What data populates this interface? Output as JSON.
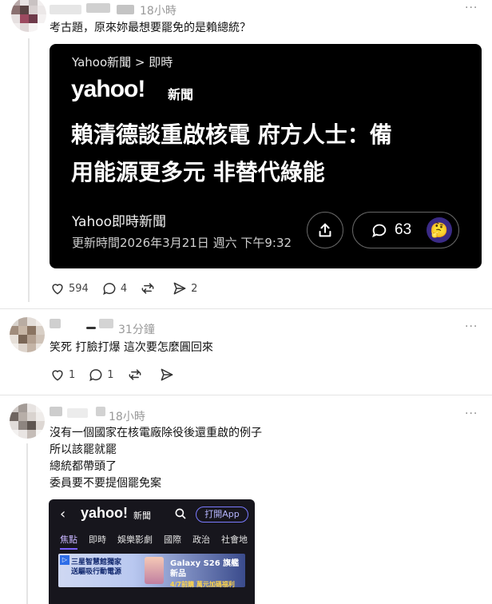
{
  "post1": {
    "time": "18小時",
    "text": "考古題，原來妳最想要罷免的是賴總統？",
    "more": "···",
    "card": {
      "crumb": "Yahoo新聞 > 即時",
      "logo": "yahoo!",
      "logo_sub": "新聞",
      "headline_line1": "賴清德談重啟核電 府方人士：備",
      "headline_line2": "用能源更多元 非替代綠能",
      "source": "Yahoo即時新聞",
      "updated": "更新時間2026年3月21日 週六 下午9:32",
      "comment_count": "63"
    },
    "likes": "594",
    "comments": "4",
    "shares": "2"
  },
  "post2": {
    "time": "31分鐘",
    "text": "笑死 打臉打爆 這次要怎麼圓回來",
    "more": "···",
    "likes": "1",
    "comments": "1"
  },
  "post3": {
    "time": "18小時",
    "more": "···",
    "lines": [
      "沒有一個國家在核電廠除役後還重啟的例子",
      "所以該罷就罷",
      "總統都帶頭了",
      "委員要不要提個罷免案"
    ],
    "phone": {
      "back": "‹",
      "logo": "yahoo!",
      "logo_sub": "新聞",
      "app_button": "打開App",
      "tabs": [
        "焦點",
        "即時",
        "娛樂影劇",
        "國際",
        "政治",
        "社會地"
      ],
      "ad_left_line1": "三星智慧館獨家",
      "ad_left_line2": "送驅吸行動電源",
      "ad_right_line1": "Galaxy S26 旗艦新品",
      "ad_right_line2": "4/7前購 萬元加碼福利"
    }
  },
  "colors": {
    "avatar_pink": "#9c4a60",
    "yahoo_purple": "#7b61ff"
  }
}
